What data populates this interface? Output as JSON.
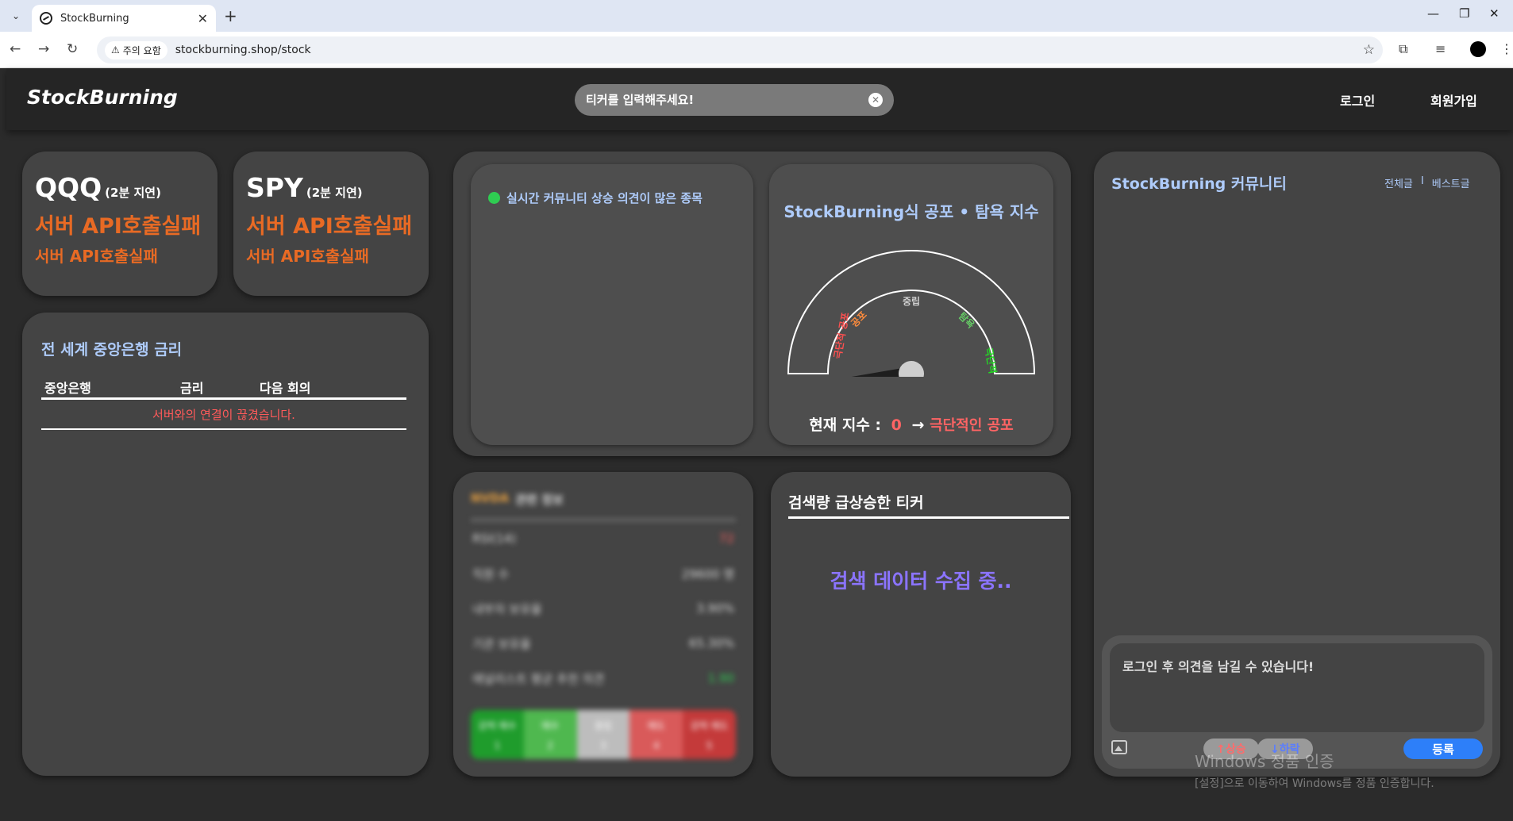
{
  "browser": {
    "tab_title": "StockBurning",
    "security_chip": "주의 요함",
    "url": "stockburning.shop/stock"
  },
  "header": {
    "logo": "StockBurning",
    "search_placeholder": "티커를 입력해주세요!",
    "login": "로그인",
    "signup": "회원가입"
  },
  "tickers": [
    {
      "name": "QQQ",
      "delay": "(2분 지연)",
      "price": "서버 API호출실패",
      "change": "서버 API호출실패"
    },
    {
      "name": "SPY",
      "delay": "(2분 지연)",
      "price": "서버 API호출실패",
      "change": "서버 API호출실패"
    }
  ],
  "central_bank": {
    "title": "전 세계 중앙은행 금리",
    "columns": [
      "중앙은행",
      "금리",
      "다음 회의"
    ],
    "message": "서버와의 연결이 끊겼습니다."
  },
  "trending": {
    "title": "실시간 커뮤니티 상승 의견이 많은 종목"
  },
  "fear_greed": {
    "title": "StockBurning식 공포 • 탐욕 지수",
    "labels": [
      "극단적 공포",
      "공포",
      "중립",
      "탐욕",
      "극단적 탐욕"
    ],
    "current_label": "현재 지수 :",
    "value": 0,
    "arrow": "→",
    "status": "극단적인 공포"
  },
  "info_panel": {
    "ticker": "NVDA",
    "title": "관련 정보",
    "rows": [
      {
        "k": "RSI(14)",
        "v": "72"
      },
      {
        "k": "직원 수",
        "v": "29600 명"
      },
      {
        "k": "내부자 보유율",
        "v": "3.90%"
      },
      {
        "k": "기관 보유율",
        "v": "65.30%"
      },
      {
        "k": "애널리스트 평균 추천 의견",
        "v": "1.90"
      }
    ],
    "scale": [
      {
        "l": "강력 매수",
        "n": "1"
      },
      {
        "l": "매수",
        "n": "2"
      },
      {
        "l": "중립",
        "n": "3"
      },
      {
        "l": "매도",
        "n": "4"
      },
      {
        "l": "강력 매도",
        "n": "5"
      }
    ]
  },
  "search_surge": {
    "title": "검색량 급상승한 티커",
    "message": "검색 데이터 수집 중.."
  },
  "community": {
    "title": "StockBurning 커뮤니티",
    "link_all": "전체글",
    "separator": "I",
    "link_best": "베스트글",
    "placeholder": "로그인 후 의견을 남길 수 있습니다!",
    "vote_up": "↑상승",
    "vote_down": "↓하락",
    "submit": "등록"
  },
  "watermark": {
    "line1": "Windows 정품 인증",
    "line2": "[설정]으로 이동하여 Windows를 정품 인증합니다."
  },
  "colors": {
    "accent_orange": "#e86a24",
    "title_blue": "#aecbfa",
    "error_red": "#ff5a5a",
    "purple": "#8b74ff",
    "submit_blue": "#2d7ff9"
  }
}
